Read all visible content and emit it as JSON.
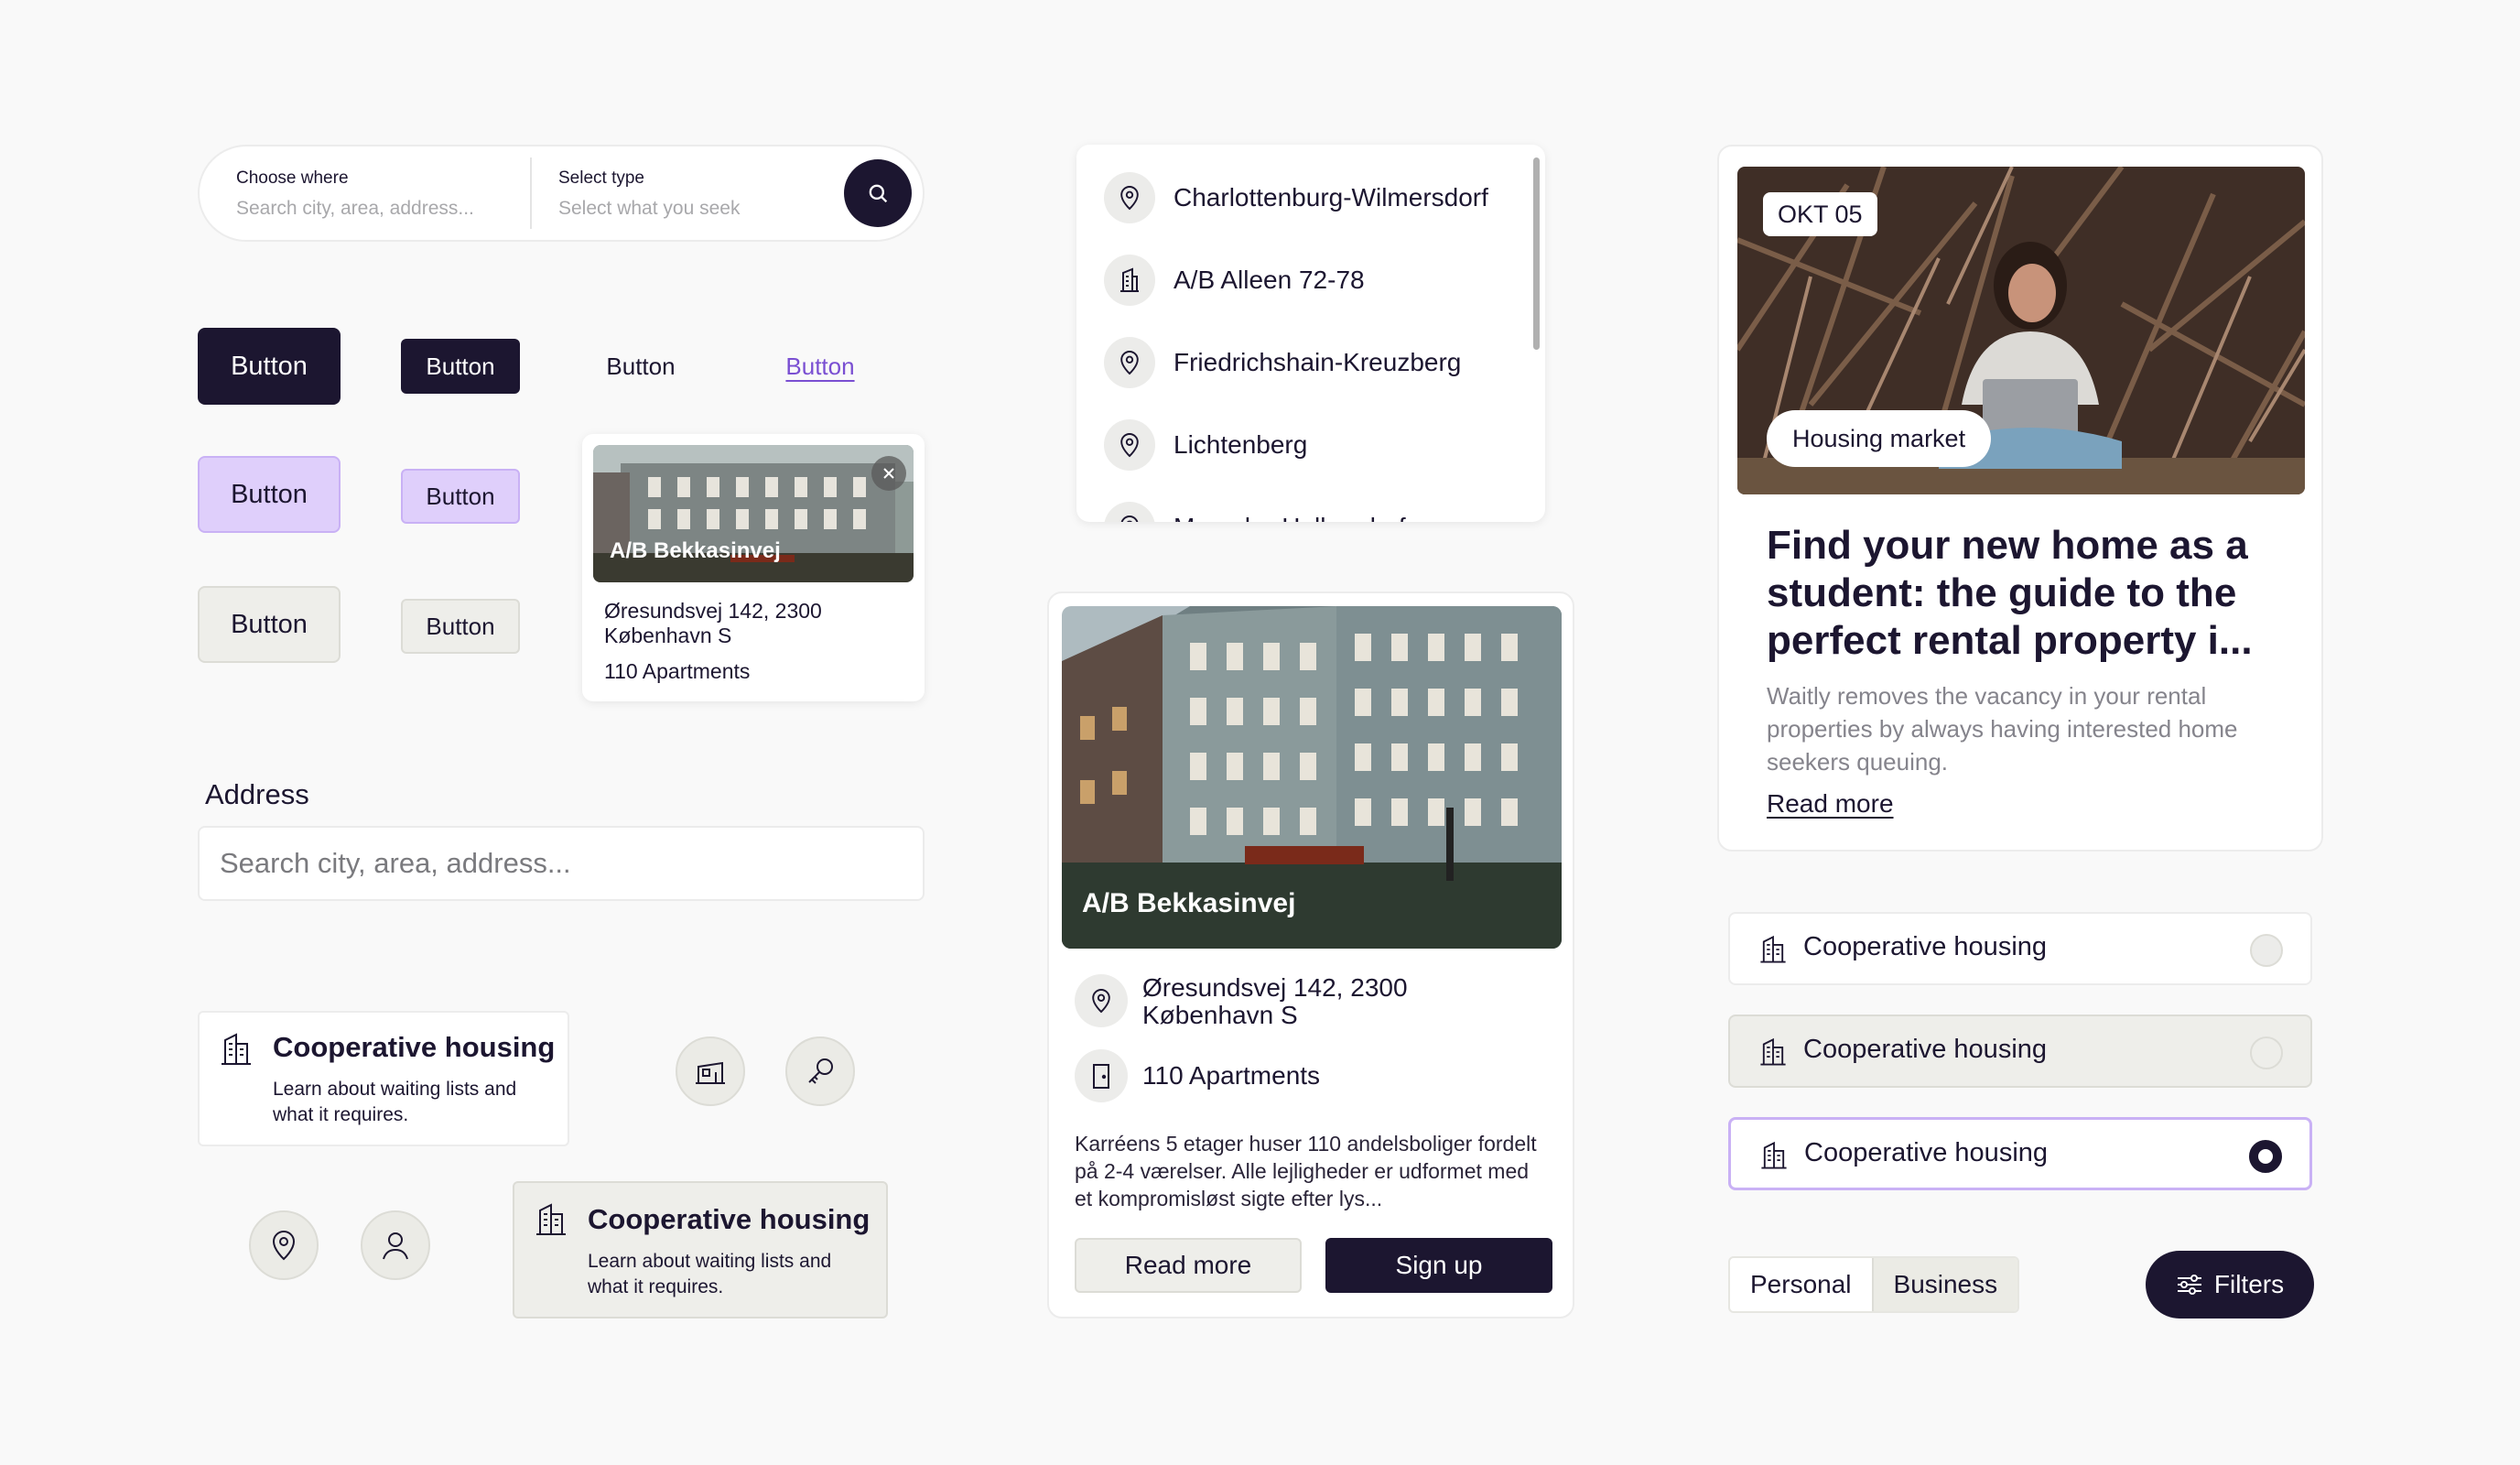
{
  "search": {
    "where_label": "Choose where",
    "where_placeholder": "Search city, area, address...",
    "type_label": "Select type",
    "type_placeholder": "Select what you seek",
    "search_icon": "search-icon"
  },
  "buttons": {
    "label": "Button"
  },
  "small_property": {
    "name": "A/B Bekkasinvej",
    "address": "Øresundsvej 142, 2300 København S",
    "apartments": "110 Apartments"
  },
  "address": {
    "label": "Address",
    "placeholder": "Search city, area, address..."
  },
  "info_card": {
    "title": "Cooperative housing",
    "description": "Learn about waiting lists and what it requires."
  },
  "dropdown": {
    "items": [
      {
        "label": "Charlottenburg-Wilmersdorf",
        "icon": "map-pin-icon"
      },
      {
        "label": "A/B Alleen 72-78",
        "icon": "building-icon"
      },
      {
        "label": "Friedrichshain-Kreuzberg",
        "icon": "map-pin-icon"
      },
      {
        "label": "Lichtenberg",
        "icon": "map-pin-icon"
      },
      {
        "label": "Marzahn-Hellersdorf",
        "icon": "map-pin-icon"
      }
    ]
  },
  "big_property": {
    "name": "A/B Bekkasinvej",
    "address": "Øresundsvej 142, 2300 København S",
    "apartments": "110 Apartments",
    "description": "Karréens 5 etager huser 110 andelsboliger fordelt på 2-4 værelser. Alle lejligheder er udformet med et kompromisløst sigte efter lys...",
    "read_more": "Read more",
    "sign_up": "Sign up"
  },
  "article": {
    "date": "OKT 05",
    "tag": "Housing market",
    "headline": "Find your new home as a student: the guide to the perfect rental property i...",
    "body": "Waitly removes the vacancy in your rental properties by always having interested home seekers queuing.",
    "read_more": "Read more"
  },
  "radio_options": {
    "label": "Cooperative housing",
    "selected_index": 2
  },
  "segmented": {
    "options": [
      "Personal",
      "Business"
    ],
    "active": "Business"
  },
  "filters": {
    "label": "Filters"
  },
  "colors": {
    "dark": "#1c1630",
    "purple_light": "#dfcffb",
    "purple_border": "#c9b1f5",
    "link_purple": "#7a4fd2",
    "gray_fill": "#eeeeea"
  }
}
